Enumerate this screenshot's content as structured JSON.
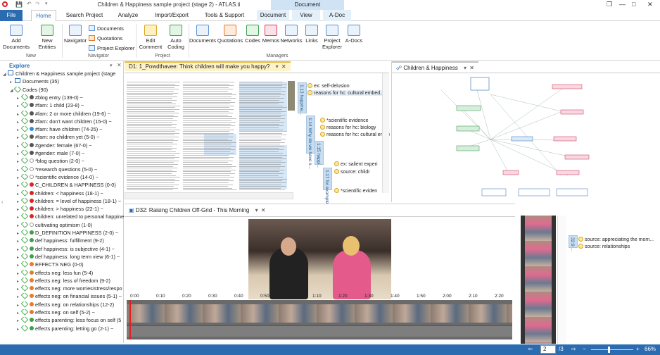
{
  "window": {
    "title": "Children & Happiness sample project (stage 2) - ATLAS.ti",
    "context_tab": "Document",
    "min": "—",
    "restore": "□",
    "close": "✕",
    "pin": "❐"
  },
  "ribbon_tabs": [
    "File",
    "Home",
    "Search Project",
    "Analyze",
    "Import/Export",
    "Tools & Support",
    "Document",
    "View",
    "A-Doc"
  ],
  "ribbon": {
    "add_documents": "Add Documents",
    "new_entities": "New Entities",
    "navigator": "Navigator",
    "documents": "Documents",
    "quotations": "Quotations",
    "project_explorer_small": "Project Explorer",
    "edit_comment": "Edit Comment",
    "auto_coding": "Auto Coding",
    "mgr_documents": "Documents",
    "mgr_quotations": "Quotations",
    "mgr_codes": "Codes",
    "mgr_memos": "Memos",
    "mgr_networks": "Networks",
    "mgr_links": "Links",
    "project_explorer": "Project Explorer",
    "a_docs": "A-Docs",
    "group_new": "New",
    "group_navigator": "Navigator",
    "group_project": "Project",
    "group_managers": "Managers"
  },
  "explorer": {
    "title": "Explore",
    "items": [
      {
        "label": "Children & Happiness sample project (stage",
        "kind": "project",
        "indent": 0
      },
      {
        "label": "Documents (35)",
        "kind": "folder",
        "indent": 1
      },
      {
        "label": "Codes (90)",
        "kind": "codes",
        "indent": 1
      },
      {
        "label": "#blog entry (139-0) ~",
        "dot": "#555",
        "indent": 2
      },
      {
        "label": "#fam: 1 child (23-8) ~",
        "dot": "#555",
        "indent": 2
      },
      {
        "label": "#fam: 2 or more children (19-6) ~",
        "dot": "#555",
        "indent": 2
      },
      {
        "label": "#fam: don't want children (15-0) ~",
        "dot": "#555",
        "indent": 2
      },
      {
        "label": "#fam: have children (74-25) ~",
        "dot": "#2b8ee6",
        "indent": 2
      },
      {
        "label": "#fam: no children yet (5-0) ~",
        "dot": "#555",
        "indent": 2
      },
      {
        "label": "#gender: female (67-0) ~",
        "dot": "#555",
        "indent": 2
      },
      {
        "label": "#gender: male (7-0) ~",
        "dot": "#555",
        "indent": 2
      },
      {
        "label": "*blog question (2-0) ~",
        "dot": "#ffffff",
        "indent": 2
      },
      {
        "label": "*research questions (5-0) ~",
        "dot": "#ffffff",
        "indent": 2
      },
      {
        "label": "*scientific evidence (14-0) ~",
        "dot": "#ffffff",
        "indent": 2
      },
      {
        "label": "C_CHILDREN & HAPPINESS (0-0)",
        "dot": "#e02020",
        "indent": 2
      },
      {
        "label": "children: < happiness (18-1) ~",
        "dot": "#e02020",
        "indent": 2
      },
      {
        "label": "children: = level of happiness (18-1) ~",
        "dot": "#e02020",
        "indent": 2
      },
      {
        "label": "children: > happiness (22-1) ~",
        "dot": "#e02020",
        "indent": 2
      },
      {
        "label": "children: unrelated to personal happine",
        "dot": "#e02020",
        "indent": 2
      },
      {
        "label": "cultivating optimism (1-0)",
        "dot": "#ffffff",
        "indent": 2
      },
      {
        "label": "D_DEFINITION HAPPINESS (2-0) ~",
        "dot": "#3aa04a",
        "indent": 2
      },
      {
        "label": "def happiness: fulfillment (9-2)",
        "dot": "#3aa04a",
        "indent": 2
      },
      {
        "label": "def happiness: is subjective (4-1) ~",
        "dot": "#3aa04a",
        "indent": 2
      },
      {
        "label": "def happiness: long term view (6-1) ~",
        "dot": "#3aa04a",
        "indent": 2
      },
      {
        "label": "EFFECTS NEG (0-0)",
        "dot": "#e87a2c",
        "indent": 2
      },
      {
        "label": "effects neg: less fun (5-4)",
        "dot": "#e87a2c",
        "indent": 2
      },
      {
        "label": "effects neg: less of freedom (9-2)",
        "dot": "#e87a2c",
        "indent": 2
      },
      {
        "label": "effects neg: more worries/stress/respo",
        "dot": "#e87a2c",
        "indent": 2
      },
      {
        "label": "effects neg: on financial issues (5-1) ~",
        "dot": "#e87a2c",
        "indent": 2
      },
      {
        "label": "effects neg: on relationships (12-2)",
        "dot": "#e87a2c",
        "indent": 2
      },
      {
        "label": "effects neg: on self (5-2) ~",
        "dot": "#e87a2c",
        "indent": 2
      },
      {
        "label": "effects parenting: less focus on self (5",
        "dot": "#3aa04a",
        "indent": 2
      },
      {
        "label": "effects parenting: letting go (2-1) ~",
        "dot": "#3aa04a",
        "indent": 2
      }
    ]
  },
  "doc_tab": "D1: 1_Powdthavee: Think children will make you happy?",
  "doc_margin": {
    "bars": [
      "1:13 happine...",
      "1:14 Why do we have k...",
      "1:15 happi...",
      "1:17 for example..."
    ],
    "codes": [
      "ex: self-delusion",
      "reasons for hc: cultural embed...",
      "*scientific evidence",
      "reasons for hc: biology",
      "reasons for hc: cultural embe",
      "ex: salient experi",
      "source: childr",
      "*scientific eviden"
    ]
  },
  "net_tab": "Children & Happiness",
  "video_tab": "D32: Raising Children Off-Grid - This Morning",
  "timeline_ticks": [
    "0:00",
    "0:10",
    "0:20",
    "0:30",
    "0:40",
    "0:50",
    "1:00",
    "1:10",
    "1:20",
    "1:30",
    "1:40",
    "1:50",
    "2:00",
    "2:10",
    "2:20"
  ],
  "video_margin": {
    "bar": "32:9 ...",
    "codes": [
      "source: appreciating the mom...",
      "source: relationships"
    ]
  },
  "status": {
    "page_value": "2",
    "page_total": "/3",
    "zoom": "66%"
  },
  "colors": {
    "accent": "#2b6cb0",
    "doc_tab_accent": "#e8b83b"
  }
}
